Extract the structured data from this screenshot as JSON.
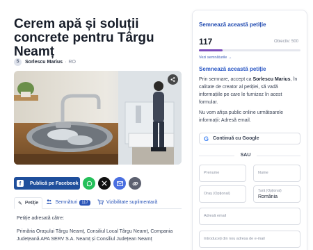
{
  "petition": {
    "title": "Cerem apă și soluții concrete pentru Târgu Neamț",
    "author_initial": "S",
    "author_name": "Sorlescu Marius",
    "author_sep": "·",
    "author_country": "RO"
  },
  "share": {
    "facebook_label": "Publică pe Facebook"
  },
  "tabs": [
    {
      "label": "Petiție"
    },
    {
      "label": "Semnături",
      "badge": "117"
    },
    {
      "label": "Vizibilitate suplimentară"
    }
  ],
  "content": {
    "addressed_label": "Petiție adresată către:",
    "addressed_text": "Primăria Orașului Târgu Neamț, Consiliul Local Târgu Neamț, Compania Județeană APA SERV S.A. Neamț și Consiliul Județean Neamț"
  },
  "sign": {
    "title": "Semnează această petiție",
    "count": "117",
    "goal": "Obiectiv: 500",
    "progress_fraction": 0.234,
    "signers_link": "Vezi semnăturile →",
    "title2": "Semnează această petiție",
    "consent_pre": "Prin semnare, accept ca ",
    "consent_name": "Sorlescu Marius",
    "consent_post": ", în calitate de creator al petiției, să vadă informațiile pe care le furnizez în acest formular.",
    "publish_note": "Nu vom afișa public online următoarele informații: Adresă email.",
    "google_label": "Continuă cu Google",
    "or_label": "SAU",
    "first_name_placeholder": "Prenume",
    "last_name_placeholder": "Nume",
    "city_placeholder": "Oraș (Opțional)",
    "country_label": "Țară (Opțional)",
    "country_value": "România",
    "email_placeholder": "Adresă email",
    "email_confirm_placeholder": "Introduceți din nou adresa de e-mail"
  },
  "colors": {
    "accent_blue": "#2b58c5",
    "progress": "#7c4dbb",
    "facebook": "#1f4f9c",
    "whatsapp": "#25c05a",
    "x": "#111111",
    "email": "#4a6fe0",
    "link": "#5d6170"
  },
  "icons": {
    "facebook": "facebook-icon",
    "whatsapp": "whatsapp-icon",
    "x": "x-icon",
    "email": "email-icon",
    "link": "link-icon",
    "petition_tab": "pencil-icon",
    "signatures_tab": "people-icon",
    "visibility_tab": "cart-icon",
    "menu": "more-icon"
  }
}
